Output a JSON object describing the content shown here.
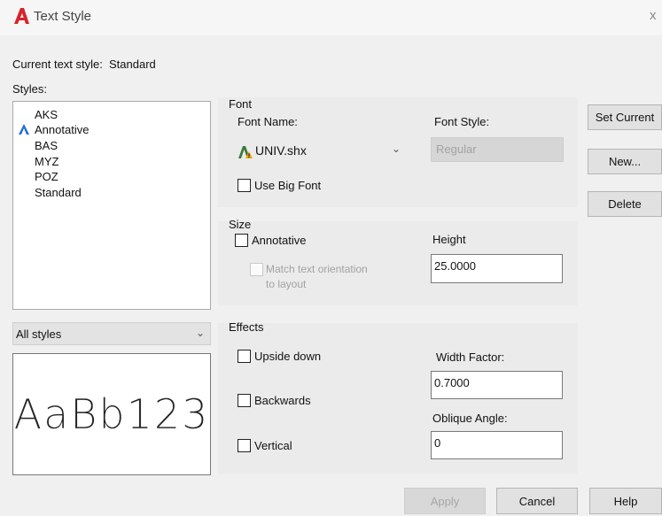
{
  "window": {
    "title": "Text Style",
    "close_glyph": "x",
    "app_icon": "autocad-a-icon",
    "accent": "#d9232e"
  },
  "current_style": {
    "label": "Current text style:",
    "value": "Standard"
  },
  "styles": {
    "label": "Styles:",
    "items": [
      {
        "name": "AKS",
        "annotative": false
      },
      {
        "name": "Annotative",
        "annotative": true
      },
      {
        "name": "BAS",
        "annotative": false
      },
      {
        "name": "MYZ",
        "annotative": false
      },
      {
        "name": "POZ",
        "annotative": false
      },
      {
        "name": "Standard",
        "annotative": false
      }
    ],
    "filter": "All styles",
    "preview": "AaBb123"
  },
  "font": {
    "group_label": "Font",
    "name_label": "Font Name:",
    "name_value": "UNIV.shx",
    "style_label": "Font Style:",
    "style_value": "Regular",
    "big_font_label": "Use Big Font"
  },
  "size": {
    "group_label": "Size",
    "annotative_label": "Annotative",
    "match_label_1": "Match text orientation",
    "match_label_2": "to layout",
    "height_label": "Height",
    "height_value": "25.0000"
  },
  "effects": {
    "group_label": "Effects",
    "upside_down": "Upside down",
    "backwards": "Backwards",
    "vertical": "Vertical",
    "width_factor_label": "Width Factor:",
    "width_factor_value": "0.7000",
    "oblique_label": "Oblique Angle:",
    "oblique_value": "0"
  },
  "buttons": {
    "set_current": "Set Current",
    "new": "New...",
    "delete": "Delete",
    "apply": "Apply",
    "cancel": "Cancel",
    "help": "Help"
  }
}
